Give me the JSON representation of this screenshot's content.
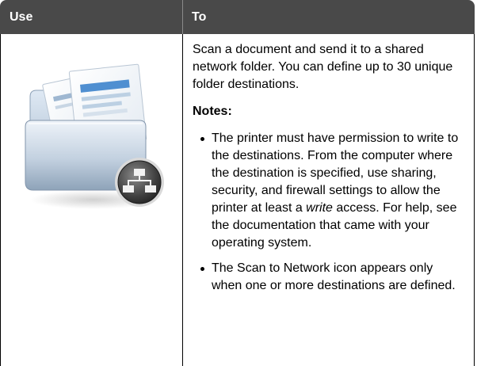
{
  "table": {
    "header": {
      "use": "Use",
      "to": "To"
    }
  },
  "row": {
    "icon": "scan-to-network-folder-icon",
    "intro": "Scan a document and send it to a shared network folder. You can define up to 30 unique folder destinations.",
    "notes_label": "Notes:",
    "notes": [
      {
        "before": "The printer must have permission to write to the destinations. From the computer where the destination is specified, use sharing, security, and firewall settings to allow the printer at least a ",
        "emphasis": "write",
        "after": " access. For help, see the documentation that came with your operating system."
      },
      {
        "text": "The Scan to Network icon appears only when one or more destinations are defined."
      }
    ]
  },
  "colors": {
    "header_bg": "#494949",
    "header_text": "#ffffff"
  }
}
